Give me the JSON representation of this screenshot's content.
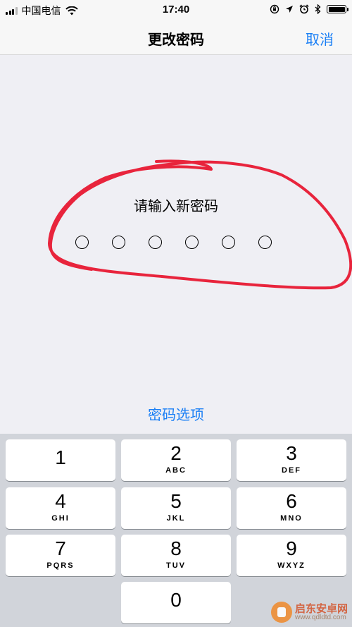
{
  "status_bar": {
    "carrier": "中国电信",
    "time": "17:40",
    "signal_bars": 4,
    "signal_bars_active": 3,
    "icons": [
      "signal-icon",
      "wifi-icon",
      "orientation-lock-icon",
      "location-icon",
      "alarm-icon",
      "bluetooth-icon",
      "battery-icon"
    ],
    "battery_level": 1.0
  },
  "nav": {
    "title": "更改密码",
    "cancel_label": "取消"
  },
  "passcode": {
    "prompt": "请输入新密码",
    "digits_total": 6,
    "digits_entered": 0
  },
  "options_link": "密码选项",
  "keypad": {
    "keys": [
      {
        "digit": "1",
        "letters": ""
      },
      {
        "digit": "2",
        "letters": "ABC"
      },
      {
        "digit": "3",
        "letters": "DEF"
      },
      {
        "digit": "4",
        "letters": "GHI"
      },
      {
        "digit": "5",
        "letters": "JKL"
      },
      {
        "digit": "6",
        "letters": "MNO"
      },
      {
        "digit": "7",
        "letters": "PQRS"
      },
      {
        "digit": "8",
        "letters": "TUV"
      },
      {
        "digit": "9",
        "letters": "WXYZ"
      },
      {
        "digit": "0",
        "letters": ""
      }
    ]
  },
  "annotation": {
    "color": "#e8243c"
  },
  "watermark": {
    "name": "启东安卓网",
    "url": "www.qdldtd.com"
  },
  "colors": {
    "accent": "#1a7ff5",
    "background": "#efeff4",
    "keypad_background": "#d1d4da"
  }
}
